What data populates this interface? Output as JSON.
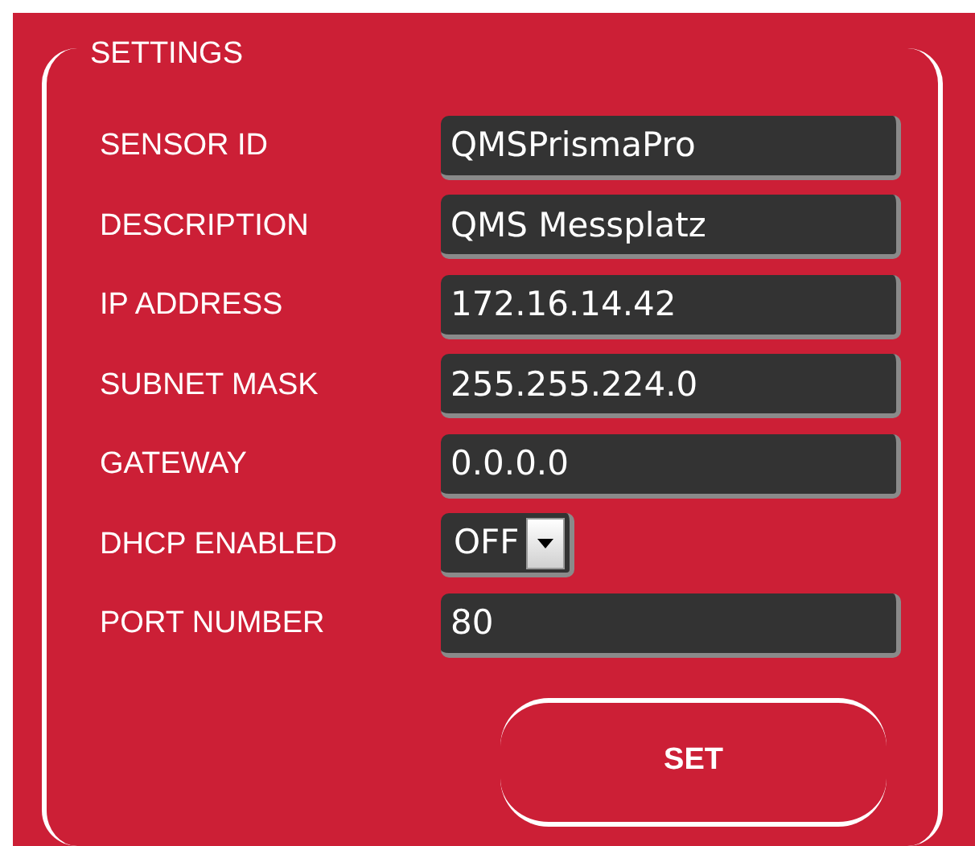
{
  "section_title": "SETTINGS",
  "fields": [
    {
      "label": "SENSOR ID",
      "kind": "text",
      "value": "QMSPrismaPro"
    },
    {
      "label": "DESCRIPTION",
      "kind": "text",
      "value": "QMS Messplatz"
    },
    {
      "label": "IP ADDRESS",
      "kind": "text",
      "value": "172.16.14.42"
    },
    {
      "label": "SUBNET MASK",
      "kind": "text",
      "value": "255.255.224.0"
    },
    {
      "label": "GATEWAY",
      "kind": "text",
      "value": "0.0.0.0"
    },
    {
      "label": "DHCP ENABLED",
      "kind": "select",
      "value": "OFF"
    },
    {
      "label": "PORT NUMBER",
      "kind": "text",
      "value": "80"
    }
  ],
  "button": "SET"
}
